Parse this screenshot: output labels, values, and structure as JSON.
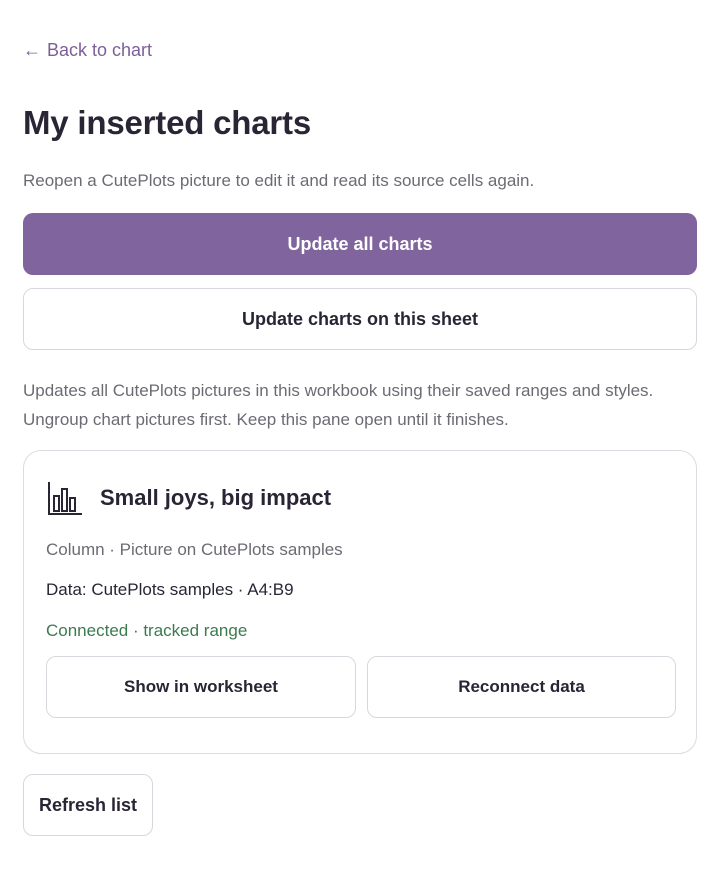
{
  "nav": {
    "back_arrow": "←",
    "back_label": "Back to chart"
  },
  "header": {
    "title": "My inserted charts",
    "subtitle": "Reopen a CutePlots picture to edit it and read its source cells again."
  },
  "actions": {
    "update_all_label": "Update all charts",
    "update_sheet_label": "Update charts on this sheet",
    "help_line_1": "Updates all CutePlots pictures in this workbook using their saved ranges and styles.",
    "help_line_2": "Ungroup chart pictures first. Keep this pane open until it finishes."
  },
  "charts": [
    {
      "icon": "bar-chart-icon",
      "title": "Small joys, big impact",
      "meta": "Column · Picture on CutePlots samples",
      "data": "Data: CutePlots samples · A4:B9",
      "status": "Connected · tracked range",
      "show_label": "Show in worksheet",
      "reconnect_label": "Reconnect data"
    }
  ],
  "footer": {
    "refresh_label": "Refresh list"
  },
  "colors": {
    "accent": "#7f649d",
    "link": "#7d5f98",
    "status_ok": "#3c7a4f",
    "muted_text": "#6e6a74",
    "border": "#d9d7de"
  }
}
